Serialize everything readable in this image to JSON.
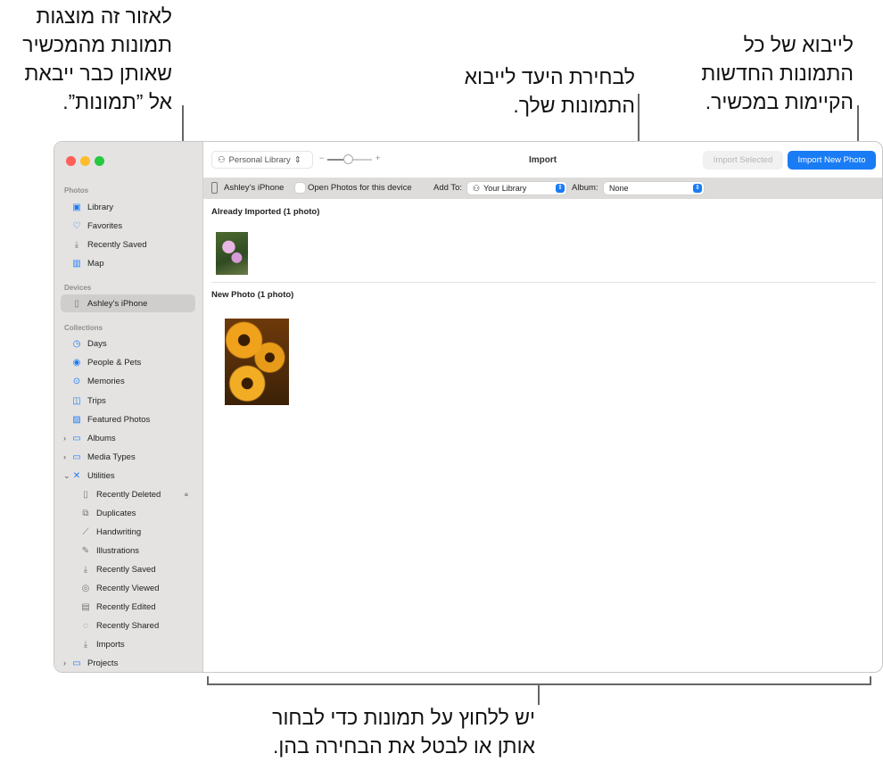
{
  "callouts": {
    "top_left": [
      "לאזור זה מוצגות",
      "תמונות מהמכשיר",
      "שאותן כבר ייבאת",
      "אל ”תמונות”."
    ],
    "top_middle": [
      "לבחירת היעד לייבוא",
      "התמונות שלך."
    ],
    "top_right": [
      "לייבוא של כל",
      "התמונות החדשות",
      "הקיימות במכשיר."
    ],
    "bottom": [
      "יש ללחוץ על תמונות כדי לבחור",
      "אותן או לבטל את הבחירה בהן."
    ]
  },
  "toolbar": {
    "library_selector": "Personal Library",
    "zoom_minus": "−",
    "zoom_plus": "+",
    "title": "Import",
    "import_selected": "Import Selected",
    "import_new": "Import New Photo",
    "zoom_value": 0.45
  },
  "import_bar": {
    "device": "Ashley’s iPhone",
    "open_photos_label": "Open Photos for this device",
    "open_photos_checked": false,
    "add_to_label": "Add To:",
    "add_to_value": "Your Library",
    "album_label": "Album:",
    "album_value": "None"
  },
  "content": {
    "already_imported": "Already Imported (1 photo)",
    "new_photo": "New Photo (1 photo)"
  },
  "sidebar": {
    "photos_header": "Photos",
    "photos": [
      "Library",
      "Favorites",
      "Recently Saved",
      "Map"
    ],
    "devices_header": "Devices",
    "device": "Ashley’s iPhone",
    "collections_header": "Collections",
    "collections": [
      "Days",
      "People & Pets",
      "Memories",
      "Trips",
      "Featured Photos",
      "Albums",
      "Media Types",
      "Utilities"
    ],
    "utilities": [
      "Recently Deleted",
      "Duplicates",
      "Handwriting",
      "Illustrations",
      "Recently Saved",
      "Recently Viewed",
      "Recently Edited",
      "Recently Shared",
      "Imports"
    ],
    "projects": "Projects"
  },
  "colors": {
    "accent": "#1a7cf5",
    "close": "#fe5f57",
    "minimize": "#febc2e",
    "zoom": "#28c840"
  }
}
